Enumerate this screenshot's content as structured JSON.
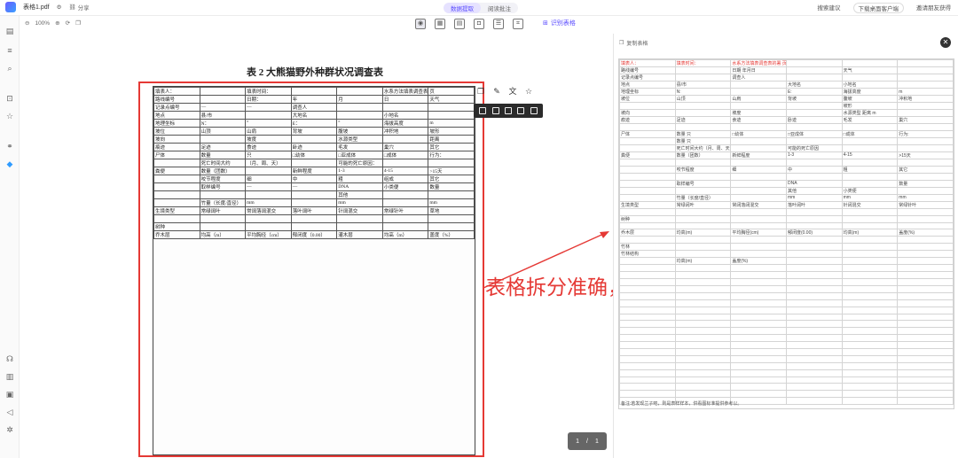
{
  "topbar": {
    "file_name": "表格1.pdf",
    "share_label": "分享",
    "modes": [
      "数据提取",
      "阅读批注"
    ],
    "right": [
      "搜索建议",
      "下载桌面客户端",
      "邀请朋友获得"
    ]
  },
  "toolbar": {
    "zoom": "100%",
    "recognize_label": "识别表格"
  },
  "document": {
    "title": "表 2   大熊猫野外种群状况调查表",
    "page_current": "1",
    "page_total": "1",
    "rows": [
      [
        "填表人：",
        "",
        "填表时间：",
        "",
        "",
        "水系方法填表调查表的署",
        "页"
      ],
      [
        "路线编号",
        "",
        "日期：",
        "年",
        "月",
        "日",
        "天气"
      ],
      [
        "记录点编号",
        "—",
        "—",
        "调查人",
        "",
        "",
        ""
      ],
      [
        "地点",
        "县/市",
        "",
        "大地名",
        "",
        "小地名",
        ""
      ],
      [
        "地理坐标",
        "N：",
        "°",
        "E：",
        "°",
        "海拔高度",
        "m"
      ],
      [
        "坡位",
        "山顶",
        "山肩",
        "背坡",
        "腹坡",
        "冲积地",
        "坡形"
      ],
      [
        "坡向",
        "",
        "坡度",
        "",
        "水源类型",
        "",
        "距离"
      ],
      [
        "痕迹",
        "足迹",
        "食迹",
        "卧迹",
        "毛发",
        "巢穴",
        "其它"
      ],
      [
        "尸体",
        "数量",
        "只",
        "□幼体",
        "□亚成体",
        "□成体",
        "行为："
      ],
      [
        "",
        "死亡时间大约",
        "（月、周、天）",
        "",
        "可能的死亡原因：",
        "",
        ""
      ],
      [
        "粪便",
        "数量（团数）",
        "",
        "新鲜程度",
        "1-3",
        "4-15",
        ">15天"
      ],
      [
        "",
        "咬节程度",
        "细",
        "中",
        "粗",
        "组成",
        "其它"
      ],
      [
        "",
        "取样编号",
        "—",
        "—",
        "DNA",
        "小类便",
        "数量"
      ],
      [
        "",
        "",
        "",
        "",
        "其他",
        "",
        ""
      ],
      [
        "",
        "竹量（长度/直径）",
        "mm",
        "",
        "mm",
        "",
        "mm"
      ],
      [
        "生境类型",
        "常绿阔叶",
        "常阔落阔混交",
        "落叶阔叶",
        "针阔混交",
        "常绿针叶",
        "草地"
      ],
      [
        "",
        "",
        "",
        "",
        "",
        "",
        ""
      ],
      [
        "树种",
        "",
        "",
        "",
        "",
        "",
        ""
      ],
      [
        "乔木层",
        "均高（m）",
        "平均胸径（cm）",
        "郁闭度（0.00）",
        "灌木层",
        "均高（m）",
        "盖度（%）"
      ]
    ]
  },
  "caption": "表格拆分准确，内容识别完整",
  "panel": {
    "header": "复制表格",
    "footer": "备注:若发现兰子吧，则是表样样本，供看图标准提供参考以。",
    "rows": [
      [
        "填表人：",
        "填表时间：",
        "水系方法填表调查表的署 页",
        "",
        "",
        ""
      ],
      [
        "路线编号",
        "",
        "日期 年月日",
        "",
        "天气",
        ""
      ],
      [
        "记录点编号",
        "",
        "调查人",
        "",
        "",
        ""
      ],
      [
        "地点",
        "县/市",
        "",
        "大地名",
        "小地名",
        ""
      ],
      [
        "地理坐标",
        "N:",
        "",
        "E:",
        "海拔高度",
        "m"
      ],
      [
        "坡位",
        "山顶",
        "山肩",
        "背坡",
        "腹坡",
        "冲积地"
      ],
      [
        "",
        "",
        "",
        "",
        "坡形",
        ""
      ],
      [
        "坡向",
        "",
        "坡度",
        "",
        "水源类型 距离 m",
        ""
      ],
      [
        "痕迹",
        "足迹",
        "食迹",
        "卧迹",
        "毛发",
        "巢穴"
      ],
      [
        "",
        "",
        "",
        "",
        "",
        ""
      ],
      [
        "尸体",
        "数量 只",
        "□幼体",
        "□亚成体",
        "□成体",
        "行为:"
      ],
      [
        "",
        "数量 只",
        "",
        "",
        "",
        ""
      ],
      [
        "",
        "死亡时间大约（月、周、天）",
        "",
        "可能的死亡原因",
        "",
        ""
      ],
      [
        "粪便",
        "数量（团数）",
        "新鲜程度",
        "1-3",
        "4-15",
        ">15天"
      ],
      [
        "",
        "",
        "",
        "",
        "",
        ""
      ],
      [
        "",
        "咬节程度",
        "细",
        "中",
        "粗",
        "其它"
      ],
      [
        "",
        "",
        "",
        "",
        "",
        ""
      ],
      [
        "",
        "取样编号",
        "",
        "DNA",
        "",
        "数量"
      ],
      [
        "",
        "",
        "",
        "其他",
        "小类便",
        ""
      ],
      [
        "",
        "竹量（长度/直径）",
        "",
        "mm",
        "mm",
        "mm"
      ],
      [
        "生境类型",
        "常绿阔叶",
        "常阔落阔混交",
        "落叶阔叶",
        "针阔混交",
        "常绿针叶"
      ],
      [
        "",
        "",
        "",
        "",
        "",
        ""
      ],
      [
        "树种",
        "",
        "",
        "",
        "",
        ""
      ],
      [
        "",
        "",
        "",
        "",
        "",
        ""
      ],
      [
        "乔木层",
        "均高(m)",
        "平均胸径(cm)",
        "郁闭度(0.00)",
        "均高(m)",
        "盖度(%)"
      ],
      [
        "",
        "",
        "",
        "",
        "",
        ""
      ],
      [
        "竹林",
        "",
        "",
        "",
        "",
        ""
      ],
      [
        "竹林结构",
        "",
        "",
        "",
        "",
        ""
      ],
      [
        "",
        "均高(m)",
        "盖度(%)",
        "",
        "",
        ""
      ],
      [
        "",
        "",
        "",
        "",
        "",
        ""
      ],
      [
        "",
        "",
        "",
        "",
        "",
        ""
      ],
      [
        "",
        "",
        "",
        "",
        "",
        ""
      ],
      [
        "",
        "",
        "",
        "",
        "",
        ""
      ],
      [
        "",
        "",
        "",
        "",
        "",
        ""
      ],
      [
        "",
        "",
        "",
        "",
        "",
        ""
      ],
      [
        "",
        "",
        "",
        "",
        "",
        ""
      ],
      [
        "",
        "",
        "",
        "",
        "",
        ""
      ],
      [
        "",
        "",
        "",
        "",
        "",
        ""
      ],
      [
        "",
        "",
        "",
        "",
        "",
        ""
      ],
      [
        "",
        "",
        "",
        "",
        "",
        ""
      ],
      [
        "",
        "",
        "",
        "",
        "",
        ""
      ],
      [
        "",
        "",
        "",
        "",
        "",
        ""
      ],
      [
        "",
        "",
        "",
        "",
        "",
        ""
      ],
      [
        "",
        "",
        "",
        "",
        "",
        ""
      ],
      [
        "",
        "",
        "",
        "",
        "",
        ""
      ],
      [
        "",
        "",
        "",
        "",
        "",
        ""
      ],
      [
        "",
        "",
        "",
        "",
        "",
        ""
      ],
      [
        "",
        "",
        "",
        "",
        "",
        ""
      ],
      [
        "",
        "",
        "",
        "",
        "",
        ""
      ]
    ]
  },
  "colors": {
    "accent": "#5b4dff",
    "highlight": "#e53935"
  }
}
